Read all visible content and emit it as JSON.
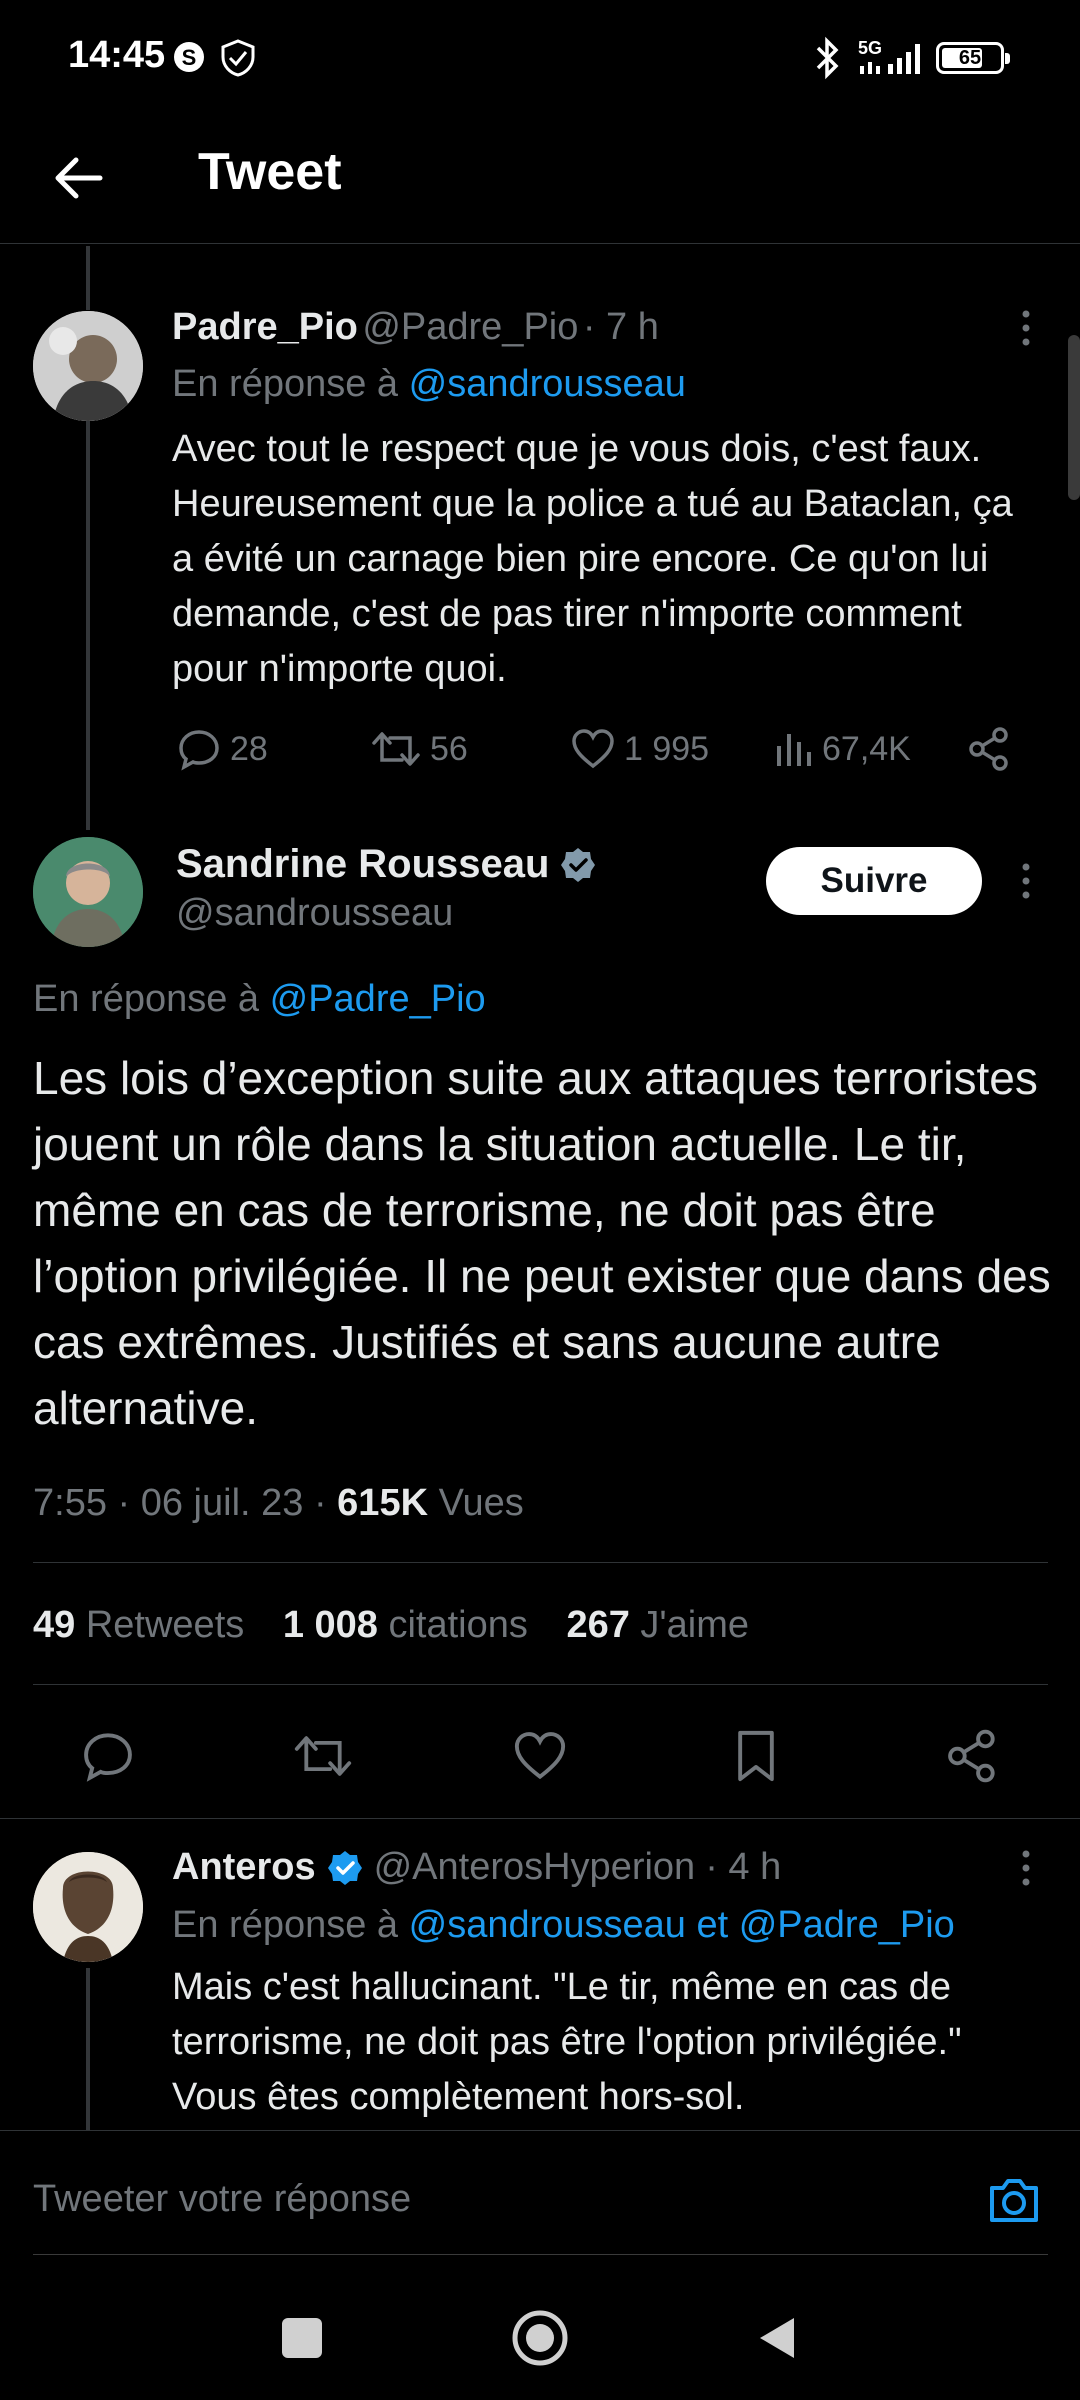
{
  "status_bar": {
    "time": "14:45",
    "network": "5G",
    "battery": "65"
  },
  "header": {
    "title": "Tweet"
  },
  "tweet_parent": {
    "name": "Padre_Pio",
    "handle": "@Padre_Pio",
    "time": "· 7 h",
    "reply_prefix": "En réponse à",
    "reply_to": "@sandrousseau",
    "text": "Avec tout le respect que je vous dois, c'est faux. Heureusement que la police a tué au Bataclan, ça a évité un carnage bien pire encore. Ce qu'on lui demande, c'est de pas tirer n'importe comment pour n'importe quoi.",
    "replies": "28",
    "retweets": "56",
    "likes": "1 995",
    "views": "67,4K"
  },
  "tweet_main": {
    "name": "Sandrine Rousseau",
    "handle": "@sandrousseau",
    "follow_label": "Suivre",
    "reply_prefix": "En réponse à",
    "reply_to": "@Padre_Pio",
    "text": "Les lois d’exception suite aux attaques terroristes jouent un rôle dans la situation actuelle. Le tir, même en cas de terrorisme, ne doit pas être l’option privilégiée. Il ne peut exister que dans des cas extrêmes. Justifiés et sans aucune autre alternative.",
    "date": "7:55 · 06 juil. 23 ·",
    "views_count": "615K",
    "views_label": "Vues",
    "retweets_count": "49",
    "retweets_label": "Retweets",
    "quotes_count": "1 008",
    "quotes_label": "citations",
    "likes_count": "267",
    "likes_label": "J'aime"
  },
  "tweet_reply": {
    "name": "Anteros",
    "handle": "@AnterosHyperion",
    "time": "· 4 h",
    "reply_prefix": "En réponse à",
    "reply_to": "@sandrousseau et @Padre_Pio",
    "text": "Mais c'est hallucinant. \"Le tir, même en cas de terrorisme, ne doit pas être l'option privilégiée.\" Vous êtes complètement hors-sol."
  },
  "composer": {
    "placeholder": "Tweeter votre réponse"
  },
  "colors": {
    "accent": "#1d9bf0",
    "muted": "#71767b",
    "background": "#000000"
  }
}
